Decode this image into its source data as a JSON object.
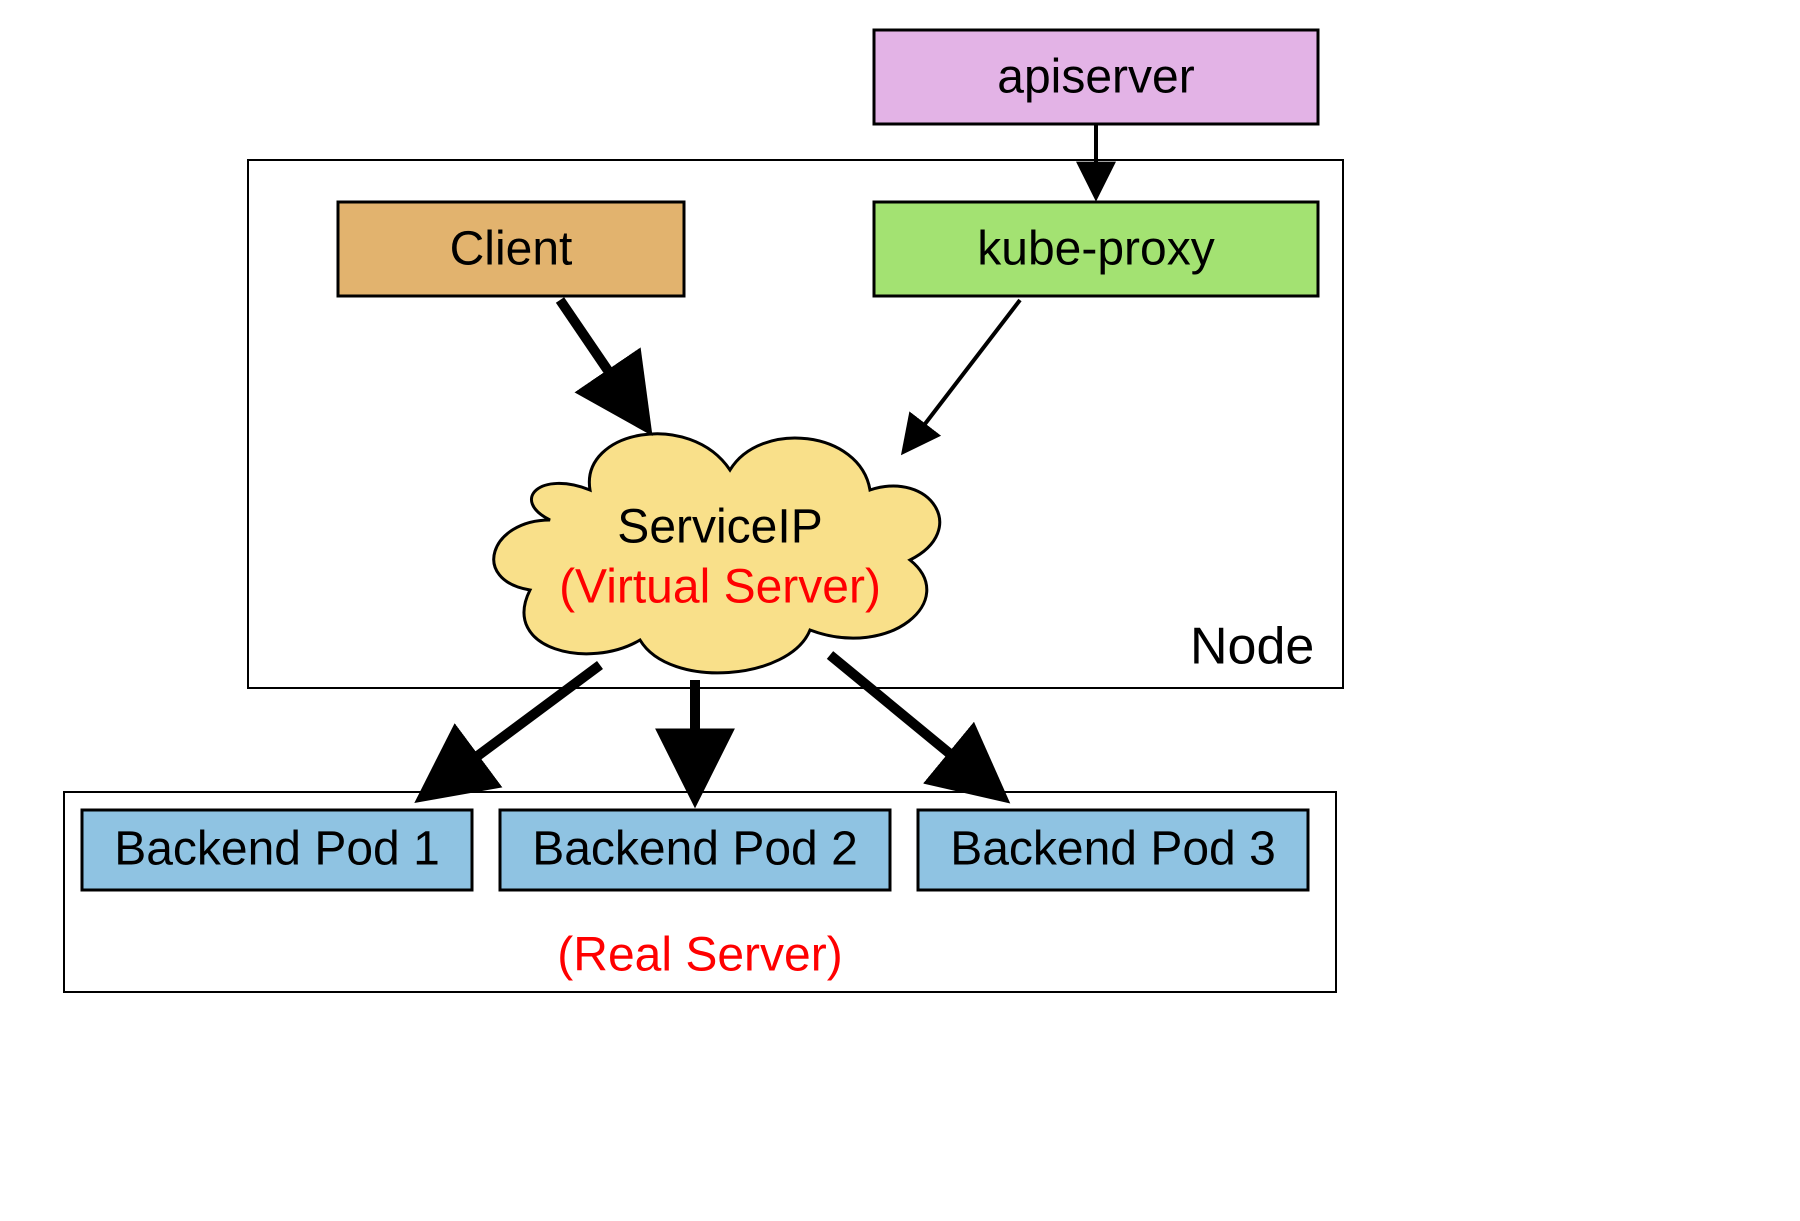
{
  "boxes": {
    "apiserver": {
      "label": "apiserver",
      "fill": "#e3b3e6",
      "stroke": "#000000"
    },
    "client": {
      "label": "Client",
      "fill": "#e2b36e",
      "stroke": "#000000"
    },
    "kubeproxy": {
      "label": "kube-proxy",
      "fill": "#a3e272",
      "stroke": "#000000"
    },
    "pod1": {
      "label": "Backend Pod 1",
      "fill": "#8fc3e2",
      "stroke": "#000000"
    },
    "pod2": {
      "label": "Backend Pod 2",
      "fill": "#8fc3e2",
      "stroke": "#000000"
    },
    "pod3": {
      "label": "Backend Pod 3",
      "fill": "#8fc3e2",
      "stroke": "#000000"
    }
  },
  "cloud": {
    "line1": "ServiceIP",
    "line2": "(Virtual Server)",
    "fill": "#f9e08a",
    "stroke": "#000000"
  },
  "container_labels": {
    "node": "Node",
    "real_server": "(Real Server)"
  },
  "colors": {
    "border": "#000000",
    "arrow_thick": "#000000",
    "arrow_thin": "#000000",
    "red": "#ff0000"
  }
}
